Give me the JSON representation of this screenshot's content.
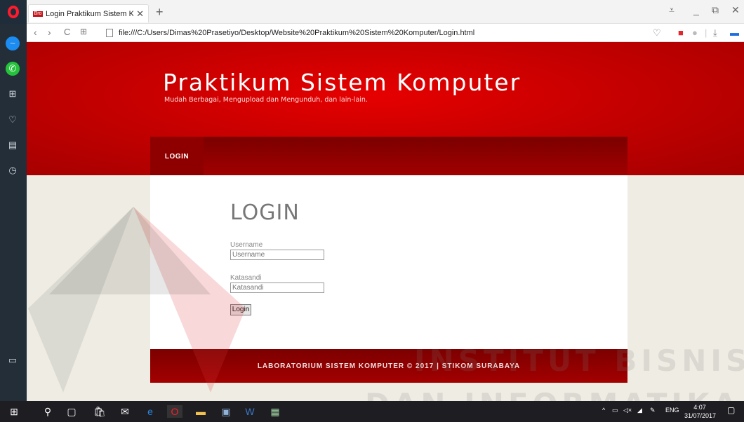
{
  "browser": {
    "tab_title": "Login Praktikum Sistem K",
    "tab_favicon_text": "Bro",
    "new_tab_label": "+",
    "url": "file:///C:/Users/Dimas%20Prasetiyo/Desktop/Website%20Praktikum%20Sistem%20Komputer/Login.html",
    "nav": {
      "back": "‹",
      "forward": "›",
      "reload": "C",
      "speed_dial": "⊞"
    },
    "window_controls": {
      "menu": "⩡",
      "minimize": "_",
      "restore": "⧉",
      "close": "✕"
    }
  },
  "sidebar_icons": [
    "messenger-icon",
    "whatsapp-icon",
    "speed-dial-icon",
    "heart-icon",
    "news-icon",
    "history-icon",
    "panel-toggle-icon"
  ],
  "site": {
    "title": "Praktikum Sistem Komputer",
    "subtitle": "Mudah Berbagai, Mengupload dan Mengunduh, dan lain-lain.",
    "menu": {
      "login": "LOGIN"
    },
    "heading": "LOGIN",
    "form": {
      "username_label": "Username",
      "username_placeholder": "Username",
      "password_label": "Katasandi",
      "password_placeholder": "Katasandi",
      "submit_label": "Login"
    },
    "footer": "LABORATORIUM SISTEM KOMPUTER © 2017 | STIKOM SURABAYA"
  },
  "watermark": {
    "line1": "INSTITUT BISNIS",
    "line2": "DAN INFORMATIKA"
  },
  "taskbar": {
    "language": "ENG",
    "time": "4:07",
    "date": "31/07/2017"
  },
  "colors": {
    "header_red": "#c70000",
    "menu_dark_red": "#8e0000",
    "background": "#efede3"
  }
}
